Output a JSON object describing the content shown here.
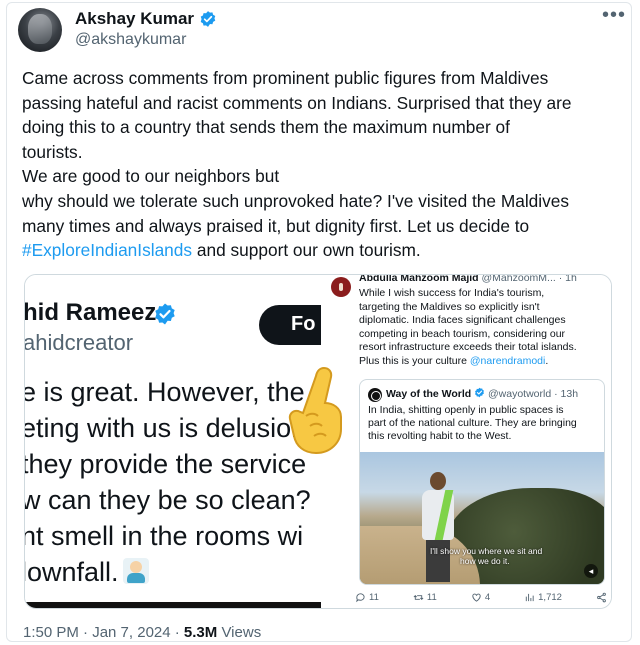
{
  "author": {
    "name": "Akshay Kumar",
    "handle": "@akshaykumar"
  },
  "more_label": "•••",
  "tweet": {
    "lines": [
      "Came across comments from prominent public figures from Maldives",
      "passing hateful and racist comments on Indians. Surprised that they are",
      "doing this to a country that sends them the maximum number of",
      "tourists.",
      "We are good to our neighbors but",
      "why should we tolerate such unprovoked hate? I've visited the Maldives",
      "many times and always praised it, but dignity first. Let us decide to"
    ],
    "hashtag": "#ExploreIndianIslands",
    "tail": " and support our own tourism."
  },
  "media_left": {
    "name": "hid Rameez",
    "handle": "ahidcreator",
    "follow_label": "Fo",
    "lines": [
      "e is great. However, the",
      "eting with us is delusion",
      " they provide the service",
      "w can they be so clean?",
      "nt smell in the rooms wi",
      "lownfall."
    ]
  },
  "media_right": {
    "author_name": "Abdulla Mahzoom Majid",
    "author_handle": "@MahzoomM... · 1h",
    "body_lines": [
      "While I wish success for India's tourism,",
      "targeting the Maldives so explicitly isn't",
      "diplomatic. India faces significant challenges",
      "competing in beach tourism, considering our",
      "resort infrastructure exceeds their total islands."
    ],
    "last_line_prefix": "Plus this is your culture ",
    "last_line_mention": "@narendramodi",
    "last_line_suffix": ".",
    "quote": {
      "name": "Way of the World",
      "handle": "@wayotworld · 13h",
      "lines": [
        "In India, shitting openly in public spaces is",
        "part of the national culture. They are bringing",
        "this revolting habit to the West."
      ],
      "video_caption_1": "I'll show you where we sit and",
      "video_caption_2": "how we do it."
    },
    "actions": {
      "replies": "11",
      "reposts": "11",
      "likes": "4",
      "views": "1,712"
    }
  },
  "meta": {
    "time": "1:50 PM · Jan 7, 2024 · ",
    "views_count": "5.3M",
    "views_label": " Views"
  }
}
